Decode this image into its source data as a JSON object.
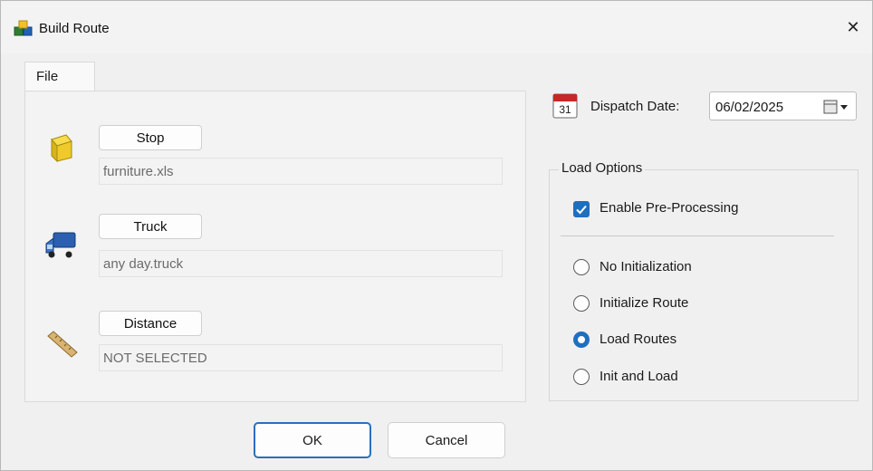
{
  "window": {
    "title": "Build Route",
    "close_glyph": "✕"
  },
  "tab": {
    "label": "File"
  },
  "files": [
    {
      "button": "Stop",
      "value": "furniture.xls",
      "icon": "box-icon"
    },
    {
      "button": "Truck",
      "value": "any day.truck",
      "icon": "truck-icon"
    },
    {
      "button": "Distance",
      "value": "NOT SELECTED",
      "icon": "ruler-icon"
    }
  ],
  "dispatch": {
    "label": "Dispatch Date:",
    "value": "06/02/2025",
    "calendar_number": "31"
  },
  "load_options": {
    "legend": "Load Options",
    "pre_processing": {
      "label": "Enable Pre-Processing",
      "checked": true
    },
    "radios": [
      {
        "label": "No Initialization",
        "selected": false
      },
      {
        "label": "Initialize Route",
        "selected": false
      },
      {
        "label": "Load Routes",
        "selected": true
      },
      {
        "label": "Init and Load",
        "selected": false
      }
    ]
  },
  "buttons": {
    "ok": "OK",
    "cancel": "Cancel"
  },
  "colors": {
    "accent": "#1f6fbf",
    "background": "#f0f0f0"
  }
}
